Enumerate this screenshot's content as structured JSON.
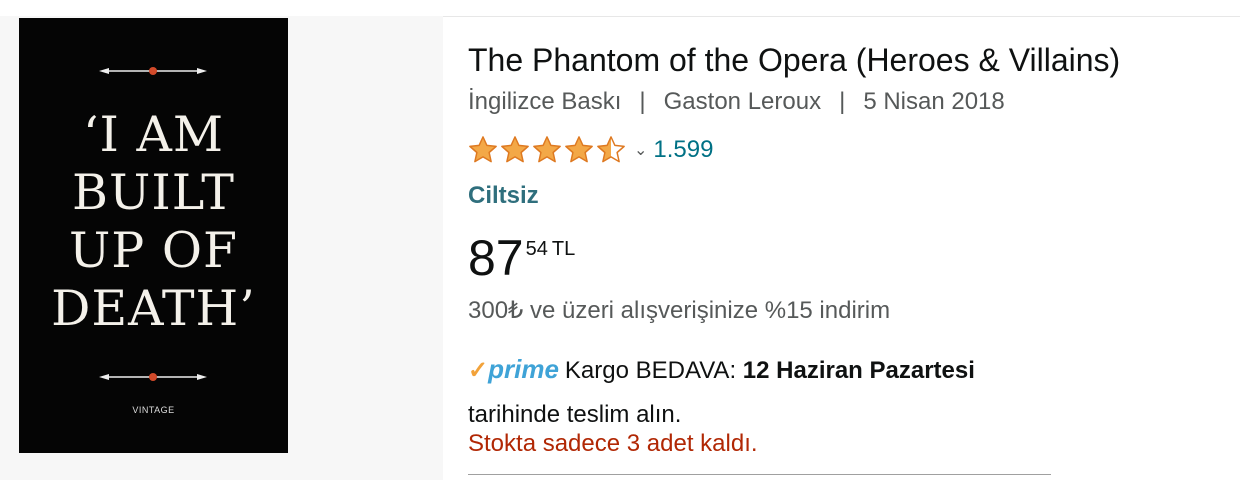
{
  "product": {
    "cover": {
      "quote_lines": "‘I AM\nBUILT\nUP OF\nDEATH’",
      "publisher": "VINTAGE"
    },
    "title": "The Phantom of the Opera (Heroes & Villains)",
    "edition": "İngilizce Baskı",
    "author": "Gaston Leroux",
    "date": "5 Nisan 2018",
    "separator": "|",
    "rating": {
      "value": 4.5,
      "max": 5,
      "chevron": "⌄",
      "count": "1.599",
      "star_color": "#f3a847"
    },
    "format": "Ciltsiz",
    "price": {
      "whole": "87",
      "fraction": "54",
      "currency": "TL"
    },
    "promo": "300₺ ve üzeri alışverişinize %15 indirim",
    "delivery": {
      "prime_check": "✓",
      "prime_label": "prime",
      "prefix": "Kargo BEDAVA: ",
      "date": "12 Haziran Pazartesi",
      "suffix": "tarihinde teslim alın."
    },
    "stock": "Stokta sadece 3 adet kaldı."
  },
  "colors": {
    "link": "#007185",
    "stock_red": "#b12704",
    "prime_blue": "#3fa3d7",
    "format_teal": "#2f6f7d"
  }
}
